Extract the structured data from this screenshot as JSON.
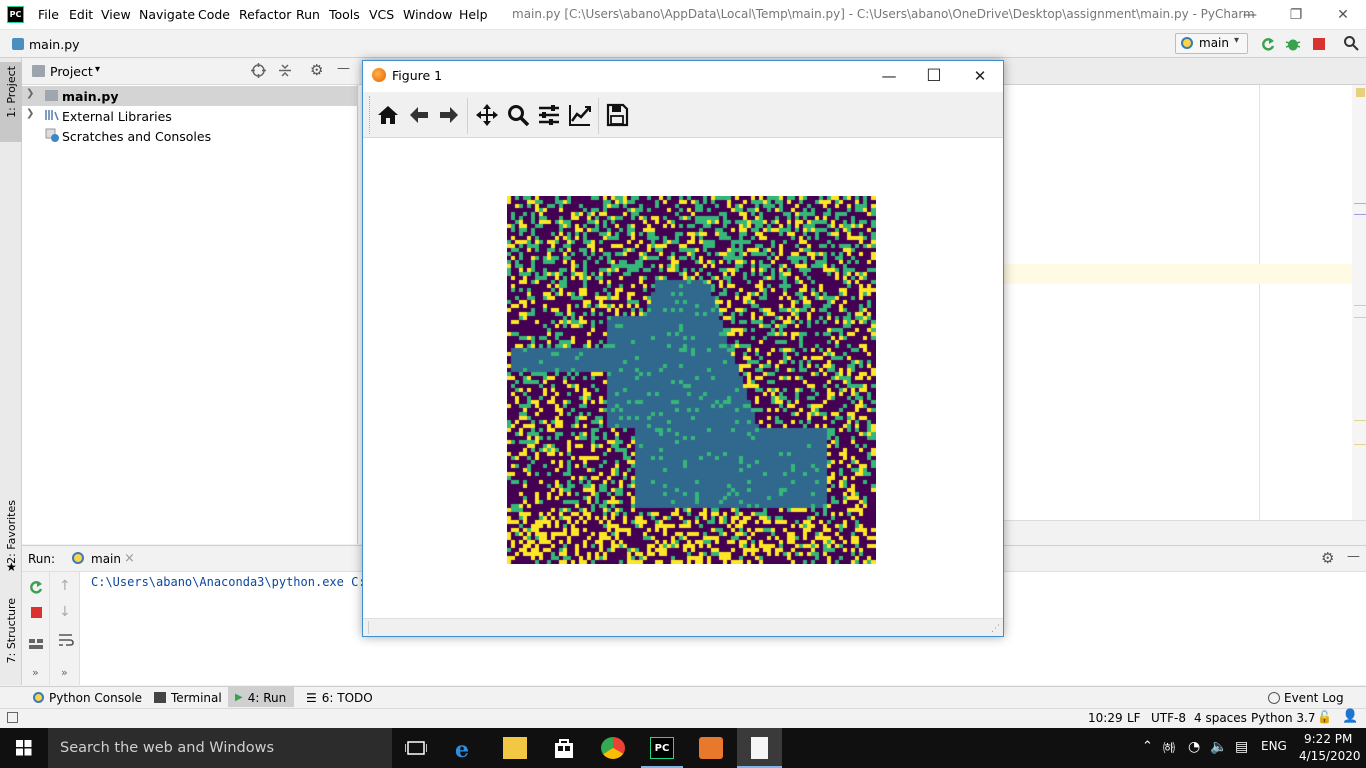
{
  "titlebar": {
    "logo_text": "PC",
    "menu": [
      "File",
      "Edit",
      "View",
      "Navigate",
      "Code",
      "Refactor",
      "Run",
      "Tools",
      "VCS",
      "Window",
      "Help"
    ],
    "title": "main.py [C:\\Users\\abano\\AppData\\Local\\Temp\\main.py] - C:\\Users\\abano\\OneDrive\\Desktop\\assignment\\main.py - PyCharm",
    "minimize": "—",
    "restore": "❐",
    "close": "✕"
  },
  "navbar": {
    "breadcrumb": "main.py",
    "run_config": "main"
  },
  "left_stripe": {
    "project_tab": "1: Project",
    "favorites_tab": "2: Favorites",
    "structure_tab": "7: Structure"
  },
  "project_panel": {
    "title": "Project",
    "tree": [
      {
        "label": "main.py",
        "bold": true
      },
      {
        "label": "External Libraries",
        "bold": false
      },
      {
        "label": "Scratches and Consoles",
        "bold": false
      }
    ]
  },
  "figure": {
    "title": "Figure 1",
    "minimize": "—",
    "maximize": "☐",
    "close": "✕",
    "tools": [
      "home-icon",
      "back-arrow-icon",
      "forward-arrow-icon",
      "pan-icon",
      "zoom-icon",
      "subplots-config-icon",
      "axes-edit-icon",
      "save-icon"
    ],
    "colormap": [
      "#440154",
      "#31688e",
      "#35b779",
      "#fde725"
    ]
  },
  "run_panel": {
    "label": "Run:",
    "tab": "main",
    "tab_close": "×",
    "console_line": "C:\\Users\\abano\\Anaconda3\\python.exe C:/"
  },
  "bottom_tools": {
    "python_console": "Python Console",
    "terminal": "Terminal",
    "run": "4: Run",
    "todo": "6: TODO",
    "event_log": "Event Log"
  },
  "status": {
    "position": "10:29",
    "line_sep": "LF",
    "encoding": "UTF-8",
    "indent": "4 spaces",
    "interpreter": "Python 3.7"
  },
  "taskbar": {
    "search": "Search the web and Windows",
    "lang": "ENG",
    "time": "9:22 PM",
    "date": "4/15/2020"
  }
}
